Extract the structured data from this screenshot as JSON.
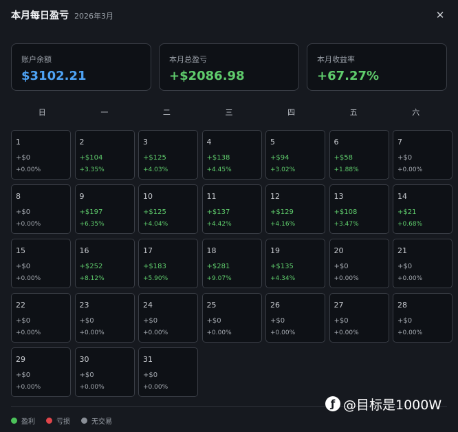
{
  "header": {
    "title": "本月每日盈亏",
    "subtitle": "2026年3月",
    "close_label": "✕"
  },
  "stats": [
    {
      "label": "账户余额",
      "value": "$3102.21",
      "color": "#4ea3f5"
    },
    {
      "label": "本月总盈亏",
      "value": "+$2086.98",
      "color": "#5fcc6c"
    },
    {
      "label": "本月收益率",
      "value": "+67.27%",
      "color": "#5fcc6c"
    }
  ],
  "weekdays": [
    "日",
    "一",
    "二",
    "三",
    "四",
    "五",
    "六"
  ],
  "days": [
    {
      "day": "1",
      "pnl": "+$0",
      "pct": "+0.00%",
      "status": "none"
    },
    {
      "day": "2",
      "pnl": "+$104",
      "pct": "+3.35%",
      "status": "profit"
    },
    {
      "day": "3",
      "pnl": "+$125",
      "pct": "+4.03%",
      "status": "profit"
    },
    {
      "day": "4",
      "pnl": "+$138",
      "pct": "+4.45%",
      "status": "profit"
    },
    {
      "day": "5",
      "pnl": "+$94",
      "pct": "+3.02%",
      "status": "profit"
    },
    {
      "day": "6",
      "pnl": "+$58",
      "pct": "+1.88%",
      "status": "profit"
    },
    {
      "day": "7",
      "pnl": "+$0",
      "pct": "+0.00%",
      "status": "none"
    },
    {
      "day": "8",
      "pnl": "+$0",
      "pct": "+0.00%",
      "status": "none"
    },
    {
      "day": "9",
      "pnl": "+$197",
      "pct": "+6.35%",
      "status": "profit"
    },
    {
      "day": "10",
      "pnl": "+$125",
      "pct": "+4.04%",
      "status": "profit"
    },
    {
      "day": "11",
      "pnl": "+$137",
      "pct": "+4.42%",
      "status": "profit"
    },
    {
      "day": "12",
      "pnl": "+$129",
      "pct": "+4.16%",
      "status": "profit"
    },
    {
      "day": "13",
      "pnl": "+$108",
      "pct": "+3.47%",
      "status": "profit"
    },
    {
      "day": "14",
      "pnl": "+$21",
      "pct": "+0.68%",
      "status": "profit"
    },
    {
      "day": "15",
      "pnl": "+$0",
      "pct": "+0.00%",
      "status": "none"
    },
    {
      "day": "16",
      "pnl": "+$252",
      "pct": "+8.12%",
      "status": "profit"
    },
    {
      "day": "17",
      "pnl": "+$183",
      "pct": "+5.90%",
      "status": "profit"
    },
    {
      "day": "18",
      "pnl": "+$281",
      "pct": "+9.07%",
      "status": "profit"
    },
    {
      "day": "19",
      "pnl": "+$135",
      "pct": "+4.34%",
      "status": "profit"
    },
    {
      "day": "20",
      "pnl": "+$0",
      "pct": "+0.00%",
      "status": "none"
    },
    {
      "day": "21",
      "pnl": "+$0",
      "pct": "+0.00%",
      "status": "none"
    },
    {
      "day": "22",
      "pnl": "+$0",
      "pct": "+0.00%",
      "status": "none"
    },
    {
      "day": "23",
      "pnl": "+$0",
      "pct": "+0.00%",
      "status": "none"
    },
    {
      "day": "24",
      "pnl": "+$0",
      "pct": "+0.00%",
      "status": "none"
    },
    {
      "day": "25",
      "pnl": "+$0",
      "pct": "+0.00%",
      "status": "none"
    },
    {
      "day": "26",
      "pnl": "+$0",
      "pct": "+0.00%",
      "status": "none"
    },
    {
      "day": "27",
      "pnl": "+$0",
      "pct": "+0.00%",
      "status": "none"
    },
    {
      "day": "28",
      "pnl": "+$0",
      "pct": "+0.00%",
      "status": "none"
    },
    {
      "day": "29",
      "pnl": "+$0",
      "pct": "+0.00%",
      "status": "none"
    },
    {
      "day": "30",
      "pnl": "+$0",
      "pct": "+0.00%",
      "status": "none"
    },
    {
      "day": "31",
      "pnl": "+$0",
      "pct": "+0.00%",
      "status": "none"
    }
  ],
  "legend": [
    {
      "label": "盈利",
      "color": "#4cc25a"
    },
    {
      "label": "亏损",
      "color": "#e0454a"
    },
    {
      "label": "无交易",
      "color": "#8a8f97"
    }
  ],
  "watermark": {
    "icon": "weibo-logo-icon",
    "text": "@目标是1000W"
  }
}
